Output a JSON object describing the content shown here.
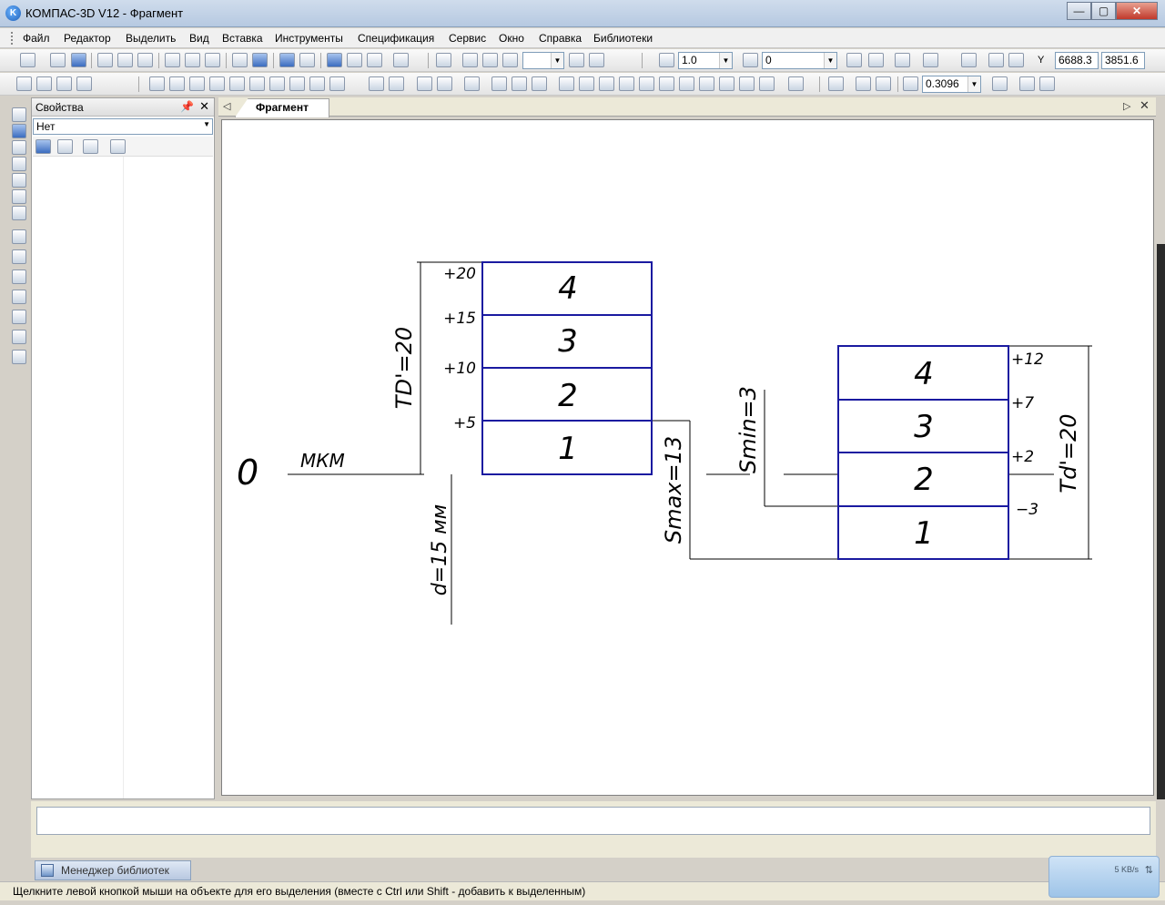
{
  "window": {
    "title": "КОМПАС-3D V12 - Фрагмент",
    "app_icon_letter": "K"
  },
  "menu": [
    "Файл",
    "Редактор",
    "Выделить",
    "Вид",
    "Вставка",
    "Инструменты",
    "Спецификация",
    "Сервис",
    "Окно",
    "Справка",
    "Библиотеки"
  ],
  "toolbar1": {
    "scale_value": "1.0",
    "layer_value": "0",
    "coord_x": "6688.3",
    "coord_y": "3851.6",
    "coord_prefix": "Y"
  },
  "toolbar2": {
    "zoom_value": "0.3096"
  },
  "properties_panel": {
    "title": "Свойства",
    "pin_icon": "pin-icon",
    "close_glyph": "✕",
    "selector_value": "Нет"
  },
  "document": {
    "tab_label": "Фрагмент"
  },
  "drawing": {
    "zero_label": "0",
    "unit_label": "МКМ",
    "hole_zones": [
      "4",
      "3",
      "2",
      "1"
    ],
    "hole_deviations": [
      "+20",
      "+15",
      "+10",
      "+5"
    ],
    "hole_tolerance": "TD'=20",
    "shaft_zones": [
      "4",
      "3",
      "2",
      "1"
    ],
    "shaft_deviations": [
      "+12",
      "+7",
      "+2",
      "−3"
    ],
    "shaft_tolerance": "Td'=20",
    "smax": "Smax=13",
    "smin": "Smin=3",
    "diameter": "d=15 мм"
  },
  "library_manager": {
    "label": "Менеджер библиотек"
  },
  "status": {
    "text": "Щелкните левой кнопкой мыши на объекте для его выделения (вместе с Ctrl или Shift - добавить к выделенным)"
  },
  "network": {
    "rate": "5 KB/s"
  },
  "window_buttons": {
    "minimize": "—",
    "maximize": "▢",
    "close": "✕"
  }
}
